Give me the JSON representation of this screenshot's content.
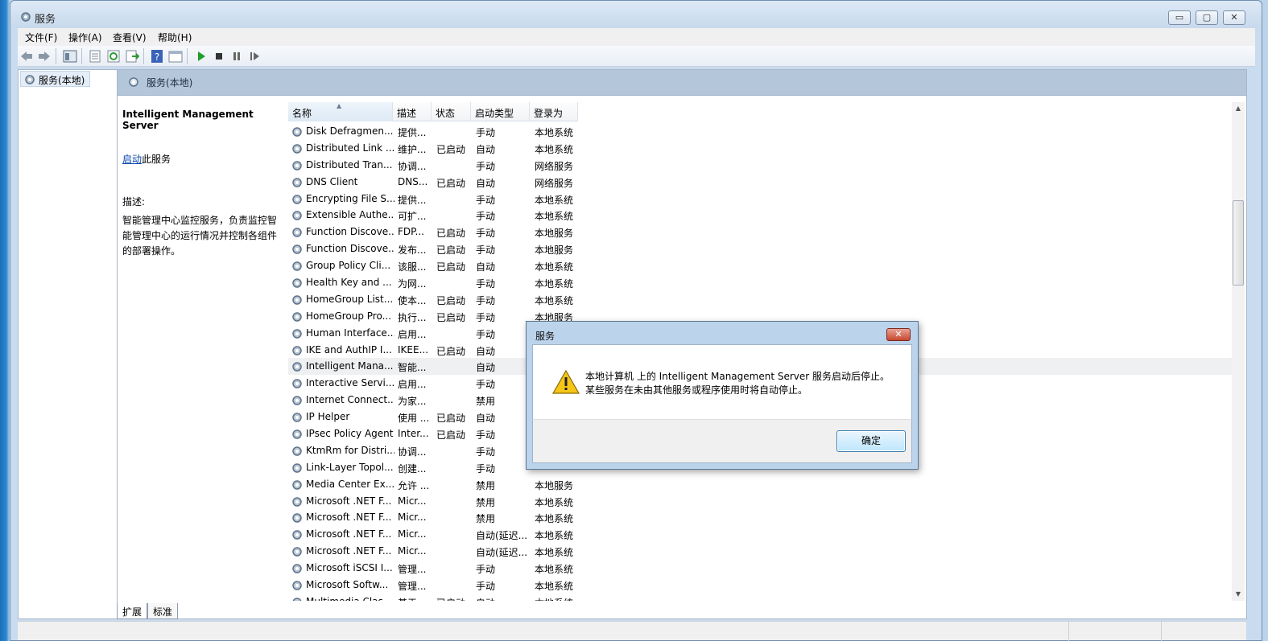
{
  "window": {
    "title": "服务",
    "buttons": {
      "minimize": "▭",
      "maximize": "▢",
      "close": "✕"
    }
  },
  "menu": {
    "items": [
      "文件(F)",
      "操作(A)",
      "查看(V)",
      "帮助(H)"
    ]
  },
  "toolbar": {
    "icons": [
      "back-icon",
      "forward-icon",
      "show-hide-tree-icon",
      "properties-icon",
      "refresh-icon",
      "export-list-icon",
      "help-icon",
      "console-icon",
      "start-service-icon",
      "stop-service-icon",
      "pause-service-icon",
      "restart-service-icon"
    ]
  },
  "tree": {
    "item_label": "服务(本地)"
  },
  "main": {
    "header_title": "服务(本地)",
    "detail": {
      "service_name": "Intelligent Management Server",
      "start_link": "启动",
      "start_suffix": "此服务",
      "desc_label": "描述:",
      "desc_text": "智能管理中心监控服务，负责监控智能管理中心的运行情况并控制各组件的部署操作。"
    },
    "columns": {
      "name": "名称",
      "desc": "描述",
      "status": "状态",
      "start_type": "启动类型",
      "logon": "登录为"
    },
    "rows": [
      {
        "name": "Disk Defragmen...",
        "desc": "提供...",
        "status": "",
        "start": "手动",
        "logon": "本地系统"
      },
      {
        "name": "Distributed Link ...",
        "desc": "维护...",
        "status": "已启动",
        "start": "自动",
        "logon": "本地系统"
      },
      {
        "name": "Distributed Tran...",
        "desc": "协调...",
        "status": "",
        "start": "手动",
        "logon": "网络服务"
      },
      {
        "name": "DNS Client",
        "desc": "DNS...",
        "status": "已启动",
        "start": "自动",
        "logon": "网络服务"
      },
      {
        "name": "Encrypting File S...",
        "desc": "提供...",
        "status": "",
        "start": "手动",
        "logon": "本地系统"
      },
      {
        "name": "Extensible Authe...",
        "desc": "可扩...",
        "status": "",
        "start": "手动",
        "logon": "本地系统"
      },
      {
        "name": "Function Discove...",
        "desc": "FDP...",
        "status": "已启动",
        "start": "手动",
        "logon": "本地服务"
      },
      {
        "name": "Function Discove...",
        "desc": "发布...",
        "status": "已启动",
        "start": "手动",
        "logon": "本地服务"
      },
      {
        "name": "Group Policy Cli...",
        "desc": "该服...",
        "status": "已启动",
        "start": "自动",
        "logon": "本地系统"
      },
      {
        "name": "Health Key and ...",
        "desc": "为网...",
        "status": "",
        "start": "手动",
        "logon": "本地系统"
      },
      {
        "name": "HomeGroup List...",
        "desc": "使本...",
        "status": "已启动",
        "start": "手动",
        "logon": "本地系统"
      },
      {
        "name": "HomeGroup Pro...",
        "desc": "执行...",
        "status": "已启动",
        "start": "手动",
        "logon": "本地服务"
      },
      {
        "name": "Human Interface...",
        "desc": "启用...",
        "status": "",
        "start": "手动",
        "logon": ""
      },
      {
        "name": "IKE and AuthIP I...",
        "desc": "IKEE...",
        "status": "已启动",
        "start": "自动",
        "logon": ""
      },
      {
        "name": "Intelligent Mana...",
        "desc": "智能...",
        "status": "",
        "start": "自动",
        "logon": ""
      },
      {
        "name": "Interactive Servi...",
        "desc": "启用...",
        "status": "",
        "start": "手动",
        "logon": ""
      },
      {
        "name": "Internet Connect...",
        "desc": "为家...",
        "status": "",
        "start": "禁用",
        "logon": ""
      },
      {
        "name": "IP Helper",
        "desc": "使用 ...",
        "status": "已启动",
        "start": "自动",
        "logon": ""
      },
      {
        "name": "IPsec Policy Agent",
        "desc": "Inter...",
        "status": "已启动",
        "start": "手动",
        "logon": ""
      },
      {
        "name": "KtmRm for Distri...",
        "desc": "协调...",
        "status": "",
        "start": "手动",
        "logon": ""
      },
      {
        "name": "Link-Layer Topol...",
        "desc": "创建...",
        "status": "",
        "start": "手动",
        "logon": ""
      },
      {
        "name": "Media Center Ex...",
        "desc": "允许 ...",
        "status": "",
        "start": "禁用",
        "logon": "本地服务"
      },
      {
        "name": "Microsoft .NET F...",
        "desc": "Micr...",
        "status": "",
        "start": "禁用",
        "logon": "本地系统"
      },
      {
        "name": "Microsoft .NET F...",
        "desc": "Micr...",
        "status": "",
        "start": "禁用",
        "logon": "本地系统"
      },
      {
        "name": "Microsoft .NET F...",
        "desc": "Micr...",
        "status": "",
        "start": "自动(延迟...",
        "logon": "本地系统"
      },
      {
        "name": "Microsoft .NET F...",
        "desc": "Micr...",
        "status": "",
        "start": "自动(延迟...",
        "logon": "本地系统"
      },
      {
        "name": "Microsoft iSCSI I...",
        "desc": "管理...",
        "status": "",
        "start": "手动",
        "logon": "本地系统"
      },
      {
        "name": "Microsoft Softw...",
        "desc": "管理...",
        "status": "",
        "start": "手动",
        "logon": "本地系统"
      },
      {
        "name": "Multimedia Clas...",
        "desc": "基于...",
        "status": "已启动",
        "start": "自动",
        "logon": "本地系统"
      }
    ],
    "selected_index": 14
  },
  "tabs": [
    "扩展",
    "标准"
  ],
  "dialog": {
    "title": "服务",
    "message_line1": "本地计算机 上的 Intelligent Management Server 服务启动后停止。",
    "message_line2": "某些服务在未由其他服务或程序使用时将自动停止。",
    "ok_label": "确定",
    "close_label": "✕"
  }
}
